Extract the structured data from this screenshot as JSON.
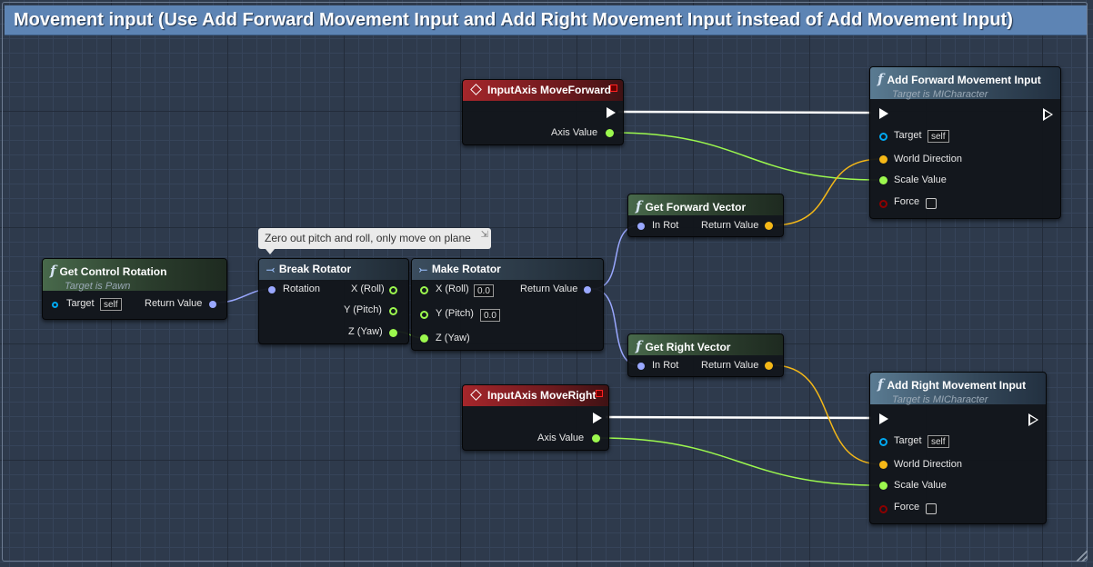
{
  "comment": {
    "title": "Movement input (Use Add Forward Movement Input and Add Right Movement Input instead of Add Movement Input)",
    "bubble": "Zero out pitch and roll, only move on plane"
  },
  "nodes": {
    "get_control_rotation": {
      "title": "Get Control Rotation",
      "subtitle": "Target is Pawn",
      "target_label": "Target",
      "target_value": "self",
      "return_label": "Return Value"
    },
    "break_rotator": {
      "title": "Break Rotator",
      "in_label": "Rotation",
      "x_label": "X (Roll)",
      "y_label": "Y (Pitch)",
      "z_label": "Z (Yaw)"
    },
    "make_rotator": {
      "title": "Make Rotator",
      "x_label": "X (Roll)",
      "x_value": "0.0",
      "y_label": "Y (Pitch)",
      "y_value": "0.0",
      "z_label": "Z (Yaw)",
      "return_label": "Return Value"
    },
    "get_forward_vector": {
      "title": "Get Forward Vector",
      "in_label": "In Rot",
      "return_label": "Return Value"
    },
    "get_right_vector": {
      "title": "Get Right Vector",
      "in_label": "In Rot",
      "return_label": "Return Value"
    },
    "input_move_forward": {
      "title": "InputAxis MoveForward",
      "axis_label": "Axis Value"
    },
    "input_move_right": {
      "title": "InputAxis MoveRight",
      "axis_label": "Axis Value"
    },
    "add_forward_input": {
      "title": "Add Forward Movement Input",
      "subtitle": "Target is MICharacter",
      "target_label": "Target",
      "target_value": "self",
      "dir_label": "World Direction",
      "scale_label": "Scale Value",
      "force_label": "Force"
    },
    "add_right_input": {
      "title": "Add Right Movement Input",
      "subtitle": "Target is MICharacter",
      "target_label": "Target",
      "target_value": "self",
      "dir_label": "World Direction",
      "scale_label": "Scale Value",
      "force_label": "Force"
    }
  },
  "pin_colors": {
    "exec": "#ffffff",
    "object": "#00a8f0",
    "vector": "#f5b817",
    "float": "#9cf84e",
    "rotator": "#9aa8ff",
    "bool": "#8c0000"
  },
  "icons": {
    "function": "f-function-icon",
    "event": "diamond-event-icon",
    "break": "break-struct-icon",
    "make": "make-struct-icon"
  }
}
